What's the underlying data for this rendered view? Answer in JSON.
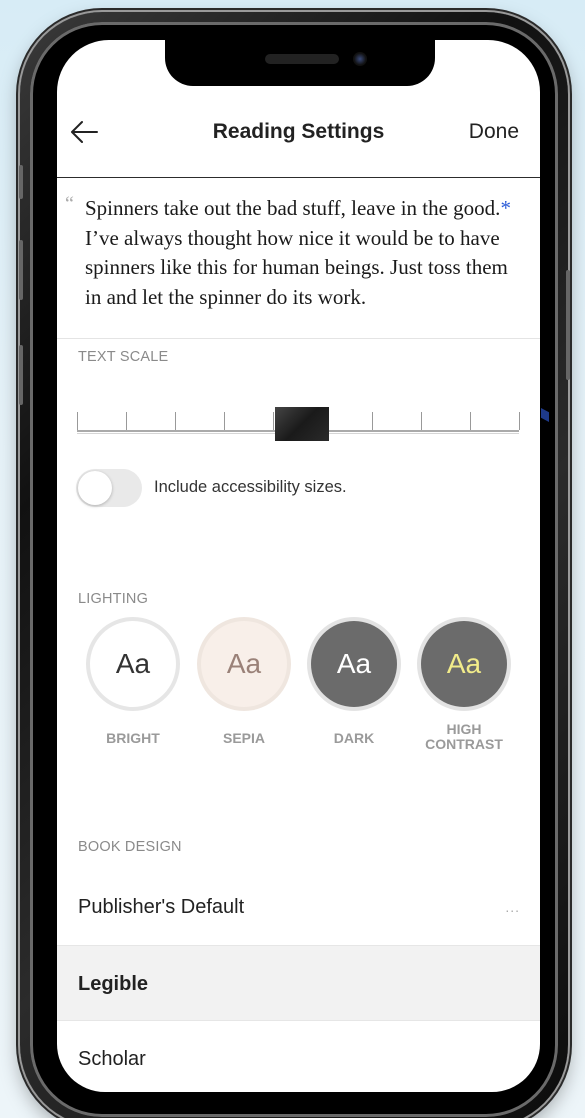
{
  "navbar": {
    "back_icon": "arrow-left-icon",
    "title": "Reading Settings",
    "done_label": "Done"
  },
  "preview": {
    "quote_mark": "“",
    "text_before": "Spinners take out the bad stuff, leave in the good.",
    "asterisk": "*",
    "text_after": " I’ve always thought how nice it would be to have spinners like this for human beings. Just toss them in and let the spinner do its work."
  },
  "text_scale": {
    "label": "TEXT SCALE",
    "level_index": 4,
    "steps": 9,
    "accessibility_toggle_label": "Include accessibility sizes.",
    "accessibility_toggle_on": false
  },
  "lighting": {
    "label": "LIGHTING",
    "themes": [
      {
        "glyph": "Aa",
        "label": "BRIGHT",
        "bg": "#ffffff",
        "fg": "#333333",
        "ring": "#e6e6e6"
      },
      {
        "glyph": "Aa",
        "label": "SEPIA",
        "bg": "#f8efe9",
        "fg": "#9a8178",
        "ring": "#efe6df"
      },
      {
        "glyph": "Aa",
        "label": "DARK",
        "bg": "#6b6b6b",
        "fg": "#ffffff",
        "ring": "#e3e3e3"
      },
      {
        "glyph": "Aa",
        "label": "HIGH CONTRAST",
        "bg": "#6b6b6b",
        "fg": "#f2ec8a",
        "ring": "#e3e3e3"
      }
    ]
  },
  "book_design": {
    "label": "BOOK DESIGN",
    "options": [
      {
        "label": "Publisher's Default",
        "more": "...",
        "selected": false
      },
      {
        "label": "Legible",
        "selected": true
      },
      {
        "label": "Scholar",
        "selected": false
      }
    ]
  }
}
